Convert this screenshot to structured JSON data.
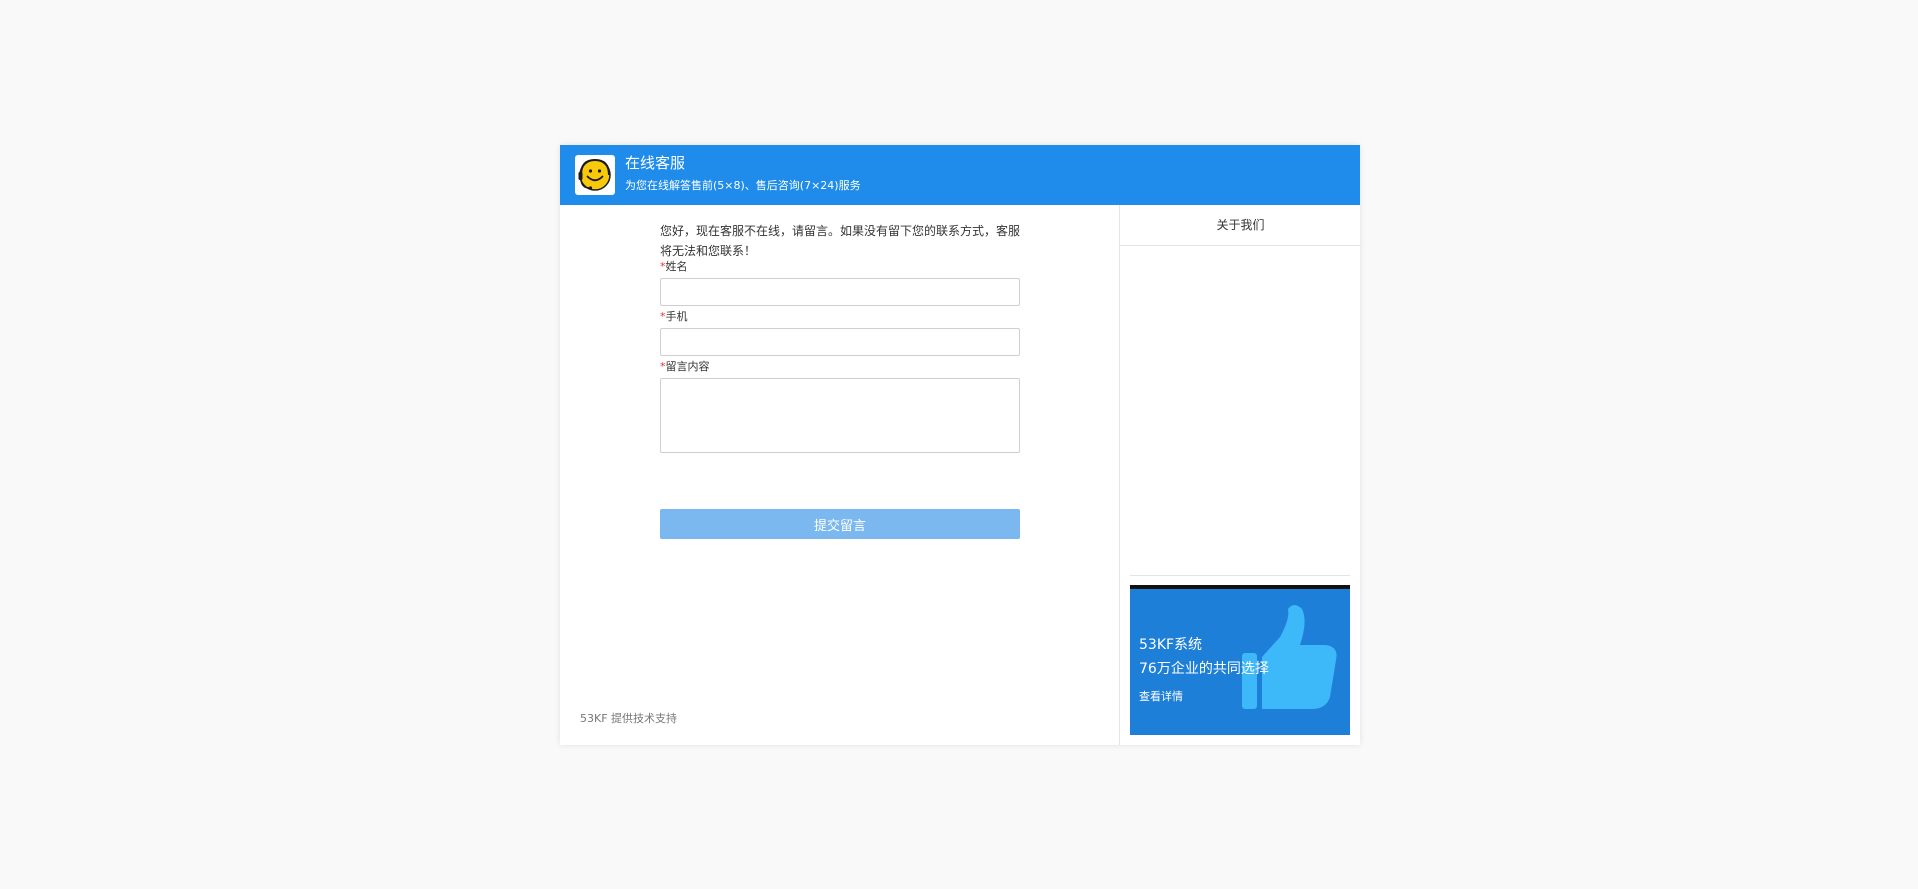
{
  "header": {
    "title": "在线客服",
    "subtitle": "为您在线解答售前(5×8)、售后咨询(7×24)服务"
  },
  "form": {
    "notice": "您好，现在客服不在线，请留言。如果没有留下您的联系方式，客服将无法和您联系！",
    "required_mark": "*",
    "name_label": "姓名",
    "name_value": "",
    "phone_label": "手机",
    "phone_value": "",
    "message_label": "留言内容",
    "message_value": "",
    "submit_label": "提交留言"
  },
  "footer": {
    "powered_by": "53KF 提供技术支持"
  },
  "sidebar": {
    "tab_label": "关于我们",
    "banner": {
      "line1": "53KF系统",
      "line2": "76万企业的共同选择",
      "link_label": "查看详情",
      "icon": "thumbs-up-icon"
    }
  },
  "colors": {
    "header_bg": "#1f8ceb",
    "submit_bg": "#7ab8ef",
    "required": "#e5333a",
    "banner_bg": "#1e7fd8",
    "thumb": "#3db8f8"
  }
}
